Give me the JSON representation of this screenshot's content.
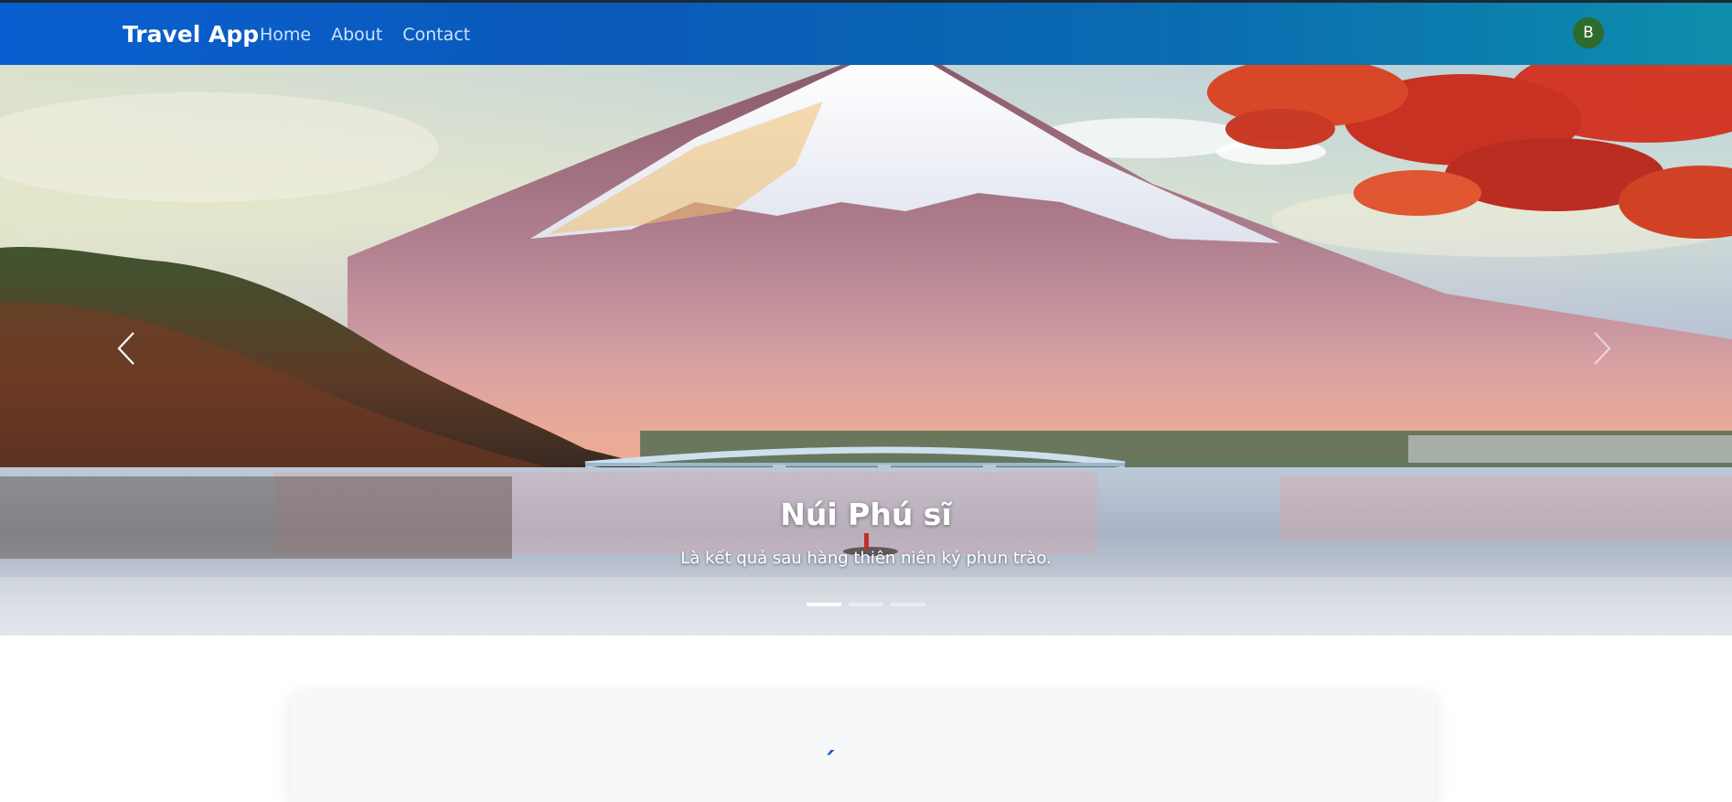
{
  "navbar": {
    "brand": "Travel App",
    "links": [
      "Home",
      "About",
      "Contact"
    ],
    "avatar_initial": "B",
    "gradient_colors": [
      "#0a5fd0",
      "#0e8eac"
    ]
  },
  "carousel": {
    "slide_title": "Núi Phú sĩ",
    "slide_text": "Là kết quả sau hàng thiên niên kỷ phun trào.",
    "slide_count": 3,
    "active_index": 0,
    "prev_icon": "chevron-left-icon",
    "next_icon": "chevron-right-icon"
  },
  "card": {
    "heading_fragment": "´"
  }
}
